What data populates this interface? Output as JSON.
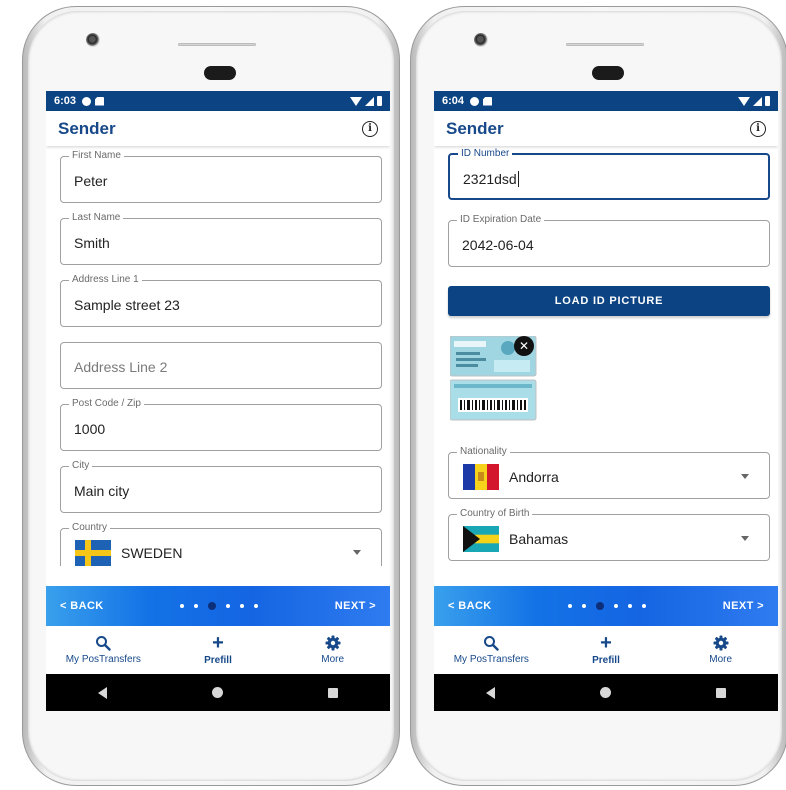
{
  "colors": {
    "primary": "#0c4383",
    "title_blue": "#17498a",
    "nav_gradient_start": "#39a0ec",
    "nav_gradient_end": "#1565e2"
  },
  "left": {
    "status": {
      "time": "6:03"
    },
    "appbar": {
      "title": "Sender",
      "info_icon": "info-icon"
    },
    "fields": [
      {
        "label": "First Name",
        "value": "Peter"
      },
      {
        "label": "Last Name",
        "value": "Smith"
      },
      {
        "label": "Address Line 1",
        "value": "Sample street 23"
      },
      {
        "placeholder": "Address Line 2"
      },
      {
        "label": "Post Code / Zip",
        "value": "1000"
      },
      {
        "label": "City",
        "value": "Main city"
      },
      {
        "label": "Country",
        "value": "SWEDEN"
      }
    ],
    "nav": {
      "back": "< BACK",
      "next": "NEXT >",
      "steps": 6,
      "active_step": 3
    },
    "bottom_nav": [
      {
        "icon": "search-icon",
        "label": "My PosTransfers"
      },
      {
        "icon": "plus-icon",
        "label": "Prefill"
      },
      {
        "icon": "gear-icon",
        "label": "More"
      }
    ]
  },
  "right": {
    "status": {
      "time": "6:04"
    },
    "appbar": {
      "title": "Sender",
      "info_icon": "info-icon"
    },
    "fields": [
      {
        "label": "ID Number",
        "value": "2321dsd",
        "focused": true
      },
      {
        "label": "ID Expiration Date",
        "value": "2042-06-04"
      },
      {
        "label": "Nationality",
        "value": "Andorra"
      },
      {
        "label": "Country of Birth",
        "value": "Bahamas"
      }
    ],
    "load_button": "LOAD ID PICTURE",
    "nav": {
      "back": "< BACK",
      "next": "NEXT >",
      "steps": 6,
      "active_step": 3
    },
    "bottom_nav": [
      {
        "icon": "search-icon",
        "label": "My PosTransfers"
      },
      {
        "icon": "plus-icon",
        "label": "Prefill"
      },
      {
        "icon": "gear-icon",
        "label": "More"
      }
    ]
  }
}
